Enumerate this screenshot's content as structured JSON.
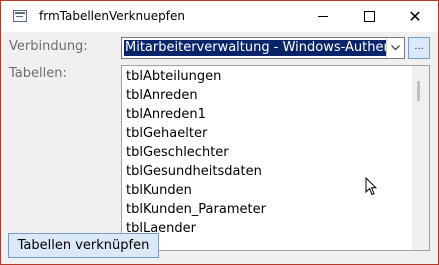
{
  "window": {
    "title": "frmTabellenVerknuepfen"
  },
  "form": {
    "verbindung_label": "Verbindung:",
    "verbindung_value": "Mitarbeiterverwaltung - Windows-Authent",
    "browse_label": "...",
    "tabellen_label": "Tabellen:",
    "tables": [
      "tblAbteilungen",
      "tblAnreden",
      "tblAnreden1",
      "tblGehaelter",
      "tblGeschlechter",
      "tblGesundheitsdaten",
      "tblKunden",
      "tblKunden_Parameter",
      "tblLaender"
    ],
    "link_button_label": "Tabellen verknüpfen"
  },
  "colors": {
    "selection": "#0a246a",
    "border_accent": "#b13b2a"
  },
  "icons": {
    "app": "form-icon",
    "minimize": "minimize-icon",
    "maximize": "maximize-icon",
    "close": "close-icon",
    "dropdown": "chevron-down-icon",
    "cursor": "mouse-cursor-icon"
  }
}
